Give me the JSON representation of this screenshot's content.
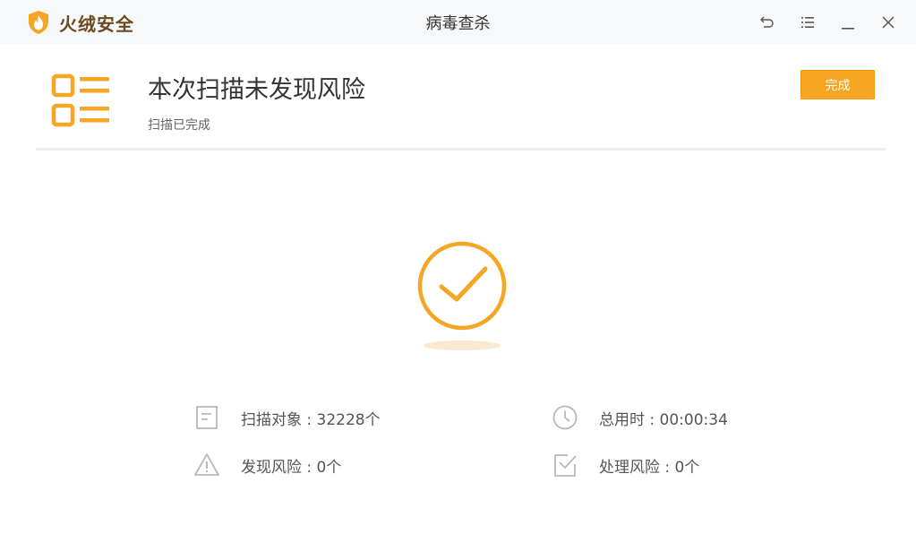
{
  "app": {
    "brand_name": "火绒安全",
    "window_title": "病毒查杀"
  },
  "colors": {
    "accent": "#f5a623",
    "brand_text": "#6b4a1e",
    "icon_gray": "#b8b8b8"
  },
  "icons": {
    "brand": "huorong-flame-shield-icon",
    "back": "back-arrow-icon",
    "menu": "menu-list-icon",
    "minimize": "minimize-icon",
    "close": "close-icon",
    "report": "report-list-icon",
    "success": "check-circle-icon"
  },
  "header": {
    "title": "本次扫描未发现风险",
    "subtitle": "扫描已完成",
    "done_label": "完成"
  },
  "stats": {
    "scanned": {
      "text": "扫描对象 : 32228个",
      "icon": "document-icon"
    },
    "duration": {
      "text": "总用时 : 00:00:34",
      "icon": "clock-icon"
    },
    "found": {
      "text": "发现风险 : 0个",
      "icon": "warning-icon"
    },
    "handled": {
      "text": "处理风险 : 0个",
      "icon": "checkbox-icon"
    }
  }
}
